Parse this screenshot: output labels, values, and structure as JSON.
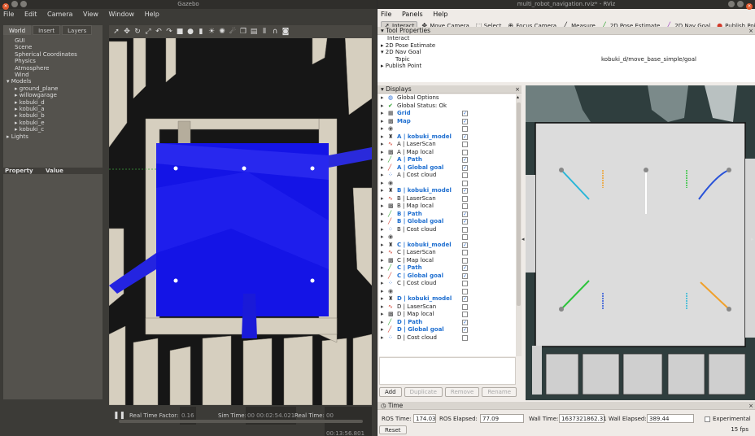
{
  "gazebo": {
    "title": "Gazebo",
    "menu": [
      "File",
      "Edit",
      "Camera",
      "View",
      "Window",
      "Help"
    ],
    "tabs": [
      "World",
      "Insert",
      "Layers"
    ],
    "tree": [
      "GUI",
      "Scene",
      "Spherical Coordinates",
      "Physics",
      "Atmosphere",
      "Wind"
    ],
    "models_label": "Models",
    "models": [
      "ground_plane",
      "willowgarage",
      "kobuki_d",
      "kobuki_a",
      "kobuki_b",
      "kobuki_e",
      "kobuki_c"
    ],
    "lights_label": "Lights",
    "prop_headers": [
      "Property",
      "Value"
    ],
    "status": {
      "rtf_label": "Real Time Factor:",
      "rtf_value": "0.16",
      "sim_label": "Sim Time:",
      "sim_value": "00 00:02:54.021",
      "real_label": "Real Time:",
      "real_value": "00 00:13:56.801"
    }
  },
  "rviz": {
    "title": "multi_robot_navigation.rviz* - RViz",
    "menu": [
      "File",
      "Panels",
      "Help"
    ],
    "toolbar": [
      {
        "label": "Interact",
        "icon": "cursor-icon",
        "active": true
      },
      {
        "label": "Move Camera",
        "icon": "move-icon",
        "active": false
      },
      {
        "label": "Select",
        "icon": "select-icon",
        "active": false
      },
      {
        "label": "Focus Camera",
        "icon": "target-icon",
        "active": false
      },
      {
        "label": "Measure",
        "icon": "ruler-icon",
        "active": false
      },
      {
        "label": "2D Pose Estimate",
        "icon": "green-arrow-icon",
        "active": false
      },
      {
        "label": "2D Nav Goal",
        "icon": "purple-arrow-icon",
        "active": false
      },
      {
        "label": "Publish Point",
        "icon": "pin-icon",
        "active": false
      }
    ],
    "tool_properties": {
      "header": "Tool Properties",
      "rows": [
        "Interact",
        "2D Pose Estimate",
        "2D Nav Goal",
        "Topic",
        "Publish Point"
      ],
      "topic_value": "kobuki_d/move_base_simple/goal"
    },
    "displays": {
      "header": "Displays",
      "items": [
        {
          "label": "Global Options",
          "bold": false,
          "check": null,
          "icon": "globe-icon"
        },
        {
          "label": "Global Status: Ok",
          "bold": false,
          "check": null,
          "icon": "check-icon"
        },
        {
          "label": "Grid",
          "bold": true,
          "check": true,
          "icon": "grid-icon"
        },
        {
          "label": "Map",
          "bold": true,
          "check": true,
          "icon": "map-icon"
        },
        {
          "label": "",
          "bold": false,
          "check": false,
          "icon": "eye-icon"
        },
        {
          "label": "A | kobuki_model",
          "bold": true,
          "check": true,
          "icon": "robot-icon"
        },
        {
          "label": "A | LaserScan",
          "bold": false,
          "check": false,
          "icon": "laser-icon"
        },
        {
          "label": "A | Map local",
          "bold": false,
          "check": false,
          "icon": "map-icon"
        },
        {
          "label": "A | Path",
          "bold": true,
          "check": true,
          "icon": "path-icon"
        },
        {
          "label": "A | Global goal",
          "bold": true,
          "check": true,
          "icon": "goal-icon"
        },
        {
          "label": "A | Cost cloud",
          "bold": false,
          "check": false,
          "icon": "cloud-icon"
        },
        {
          "label": "",
          "bold": false,
          "check": false,
          "icon": "eye-icon"
        },
        {
          "label": "B | kobuki_model",
          "bold": true,
          "check": true,
          "icon": "robot-icon"
        },
        {
          "label": "B | LaserScan",
          "bold": false,
          "check": false,
          "icon": "laser-icon"
        },
        {
          "label": "B | Map local",
          "bold": false,
          "check": false,
          "icon": "map-icon"
        },
        {
          "label": "B | Path",
          "bold": true,
          "check": true,
          "icon": "path-icon"
        },
        {
          "label": "B | Global goal",
          "bold": true,
          "check": true,
          "icon": "goal-icon"
        },
        {
          "label": "B | Cost cloud",
          "bold": false,
          "check": false,
          "icon": "cloud-icon"
        },
        {
          "label": "",
          "bold": false,
          "check": false,
          "icon": "eye-icon"
        },
        {
          "label": "C | kobuki_model",
          "bold": true,
          "check": true,
          "icon": "robot-icon"
        },
        {
          "label": "C | LaserScan",
          "bold": false,
          "check": false,
          "icon": "laser-icon"
        },
        {
          "label": "C | Map local",
          "bold": false,
          "check": false,
          "icon": "map-icon"
        },
        {
          "label": "C | Path",
          "bold": true,
          "check": true,
          "icon": "path-icon"
        },
        {
          "label": "C | Global goal",
          "bold": true,
          "check": true,
          "icon": "goal-icon"
        },
        {
          "label": "C | Cost cloud",
          "bold": false,
          "check": false,
          "icon": "cloud-icon"
        },
        {
          "label": "",
          "bold": false,
          "check": false,
          "icon": "eye-icon"
        },
        {
          "label": "D | kobuki_model",
          "bold": true,
          "check": true,
          "icon": "robot-icon"
        },
        {
          "label": "D | LaserScan",
          "bold": false,
          "check": false,
          "icon": "laser-icon"
        },
        {
          "label": "D | Map local",
          "bold": false,
          "check": false,
          "icon": "map-icon"
        },
        {
          "label": "D | Path",
          "bold": true,
          "check": true,
          "icon": "path-icon"
        },
        {
          "label": "D | Global goal",
          "bold": true,
          "check": true,
          "icon": "goal-icon"
        },
        {
          "label": "D | Cost cloud",
          "bold": false,
          "check": false,
          "icon": "cloud-icon"
        }
      ],
      "buttons": [
        "Add",
        "Duplicate",
        "Remove",
        "Rename"
      ]
    },
    "time": {
      "header": "Time",
      "ros_time_label": "ROS Time:",
      "ros_time": "174.03",
      "ros_elapsed_label": "ROS Elapsed:",
      "ros_elapsed": "77.09",
      "wall_time_label": "Wall Time:",
      "wall_time": "1637321862.31",
      "wall_elapsed_label": "Wall Elapsed:",
      "wall_elapsed": "389.44",
      "experimental_label": "Experimental",
      "reset_label": "Reset",
      "fps": "15 fps"
    }
  },
  "colors": {
    "accent": "#1f6fd0",
    "laser_blue": "#1414e6",
    "map_bg": "#2f3e3e",
    "path_cyan": "#29b6d8",
    "path_green": "#2ec43c",
    "path_orange": "#f0a02a",
    "path_blue": "#2852d8"
  }
}
